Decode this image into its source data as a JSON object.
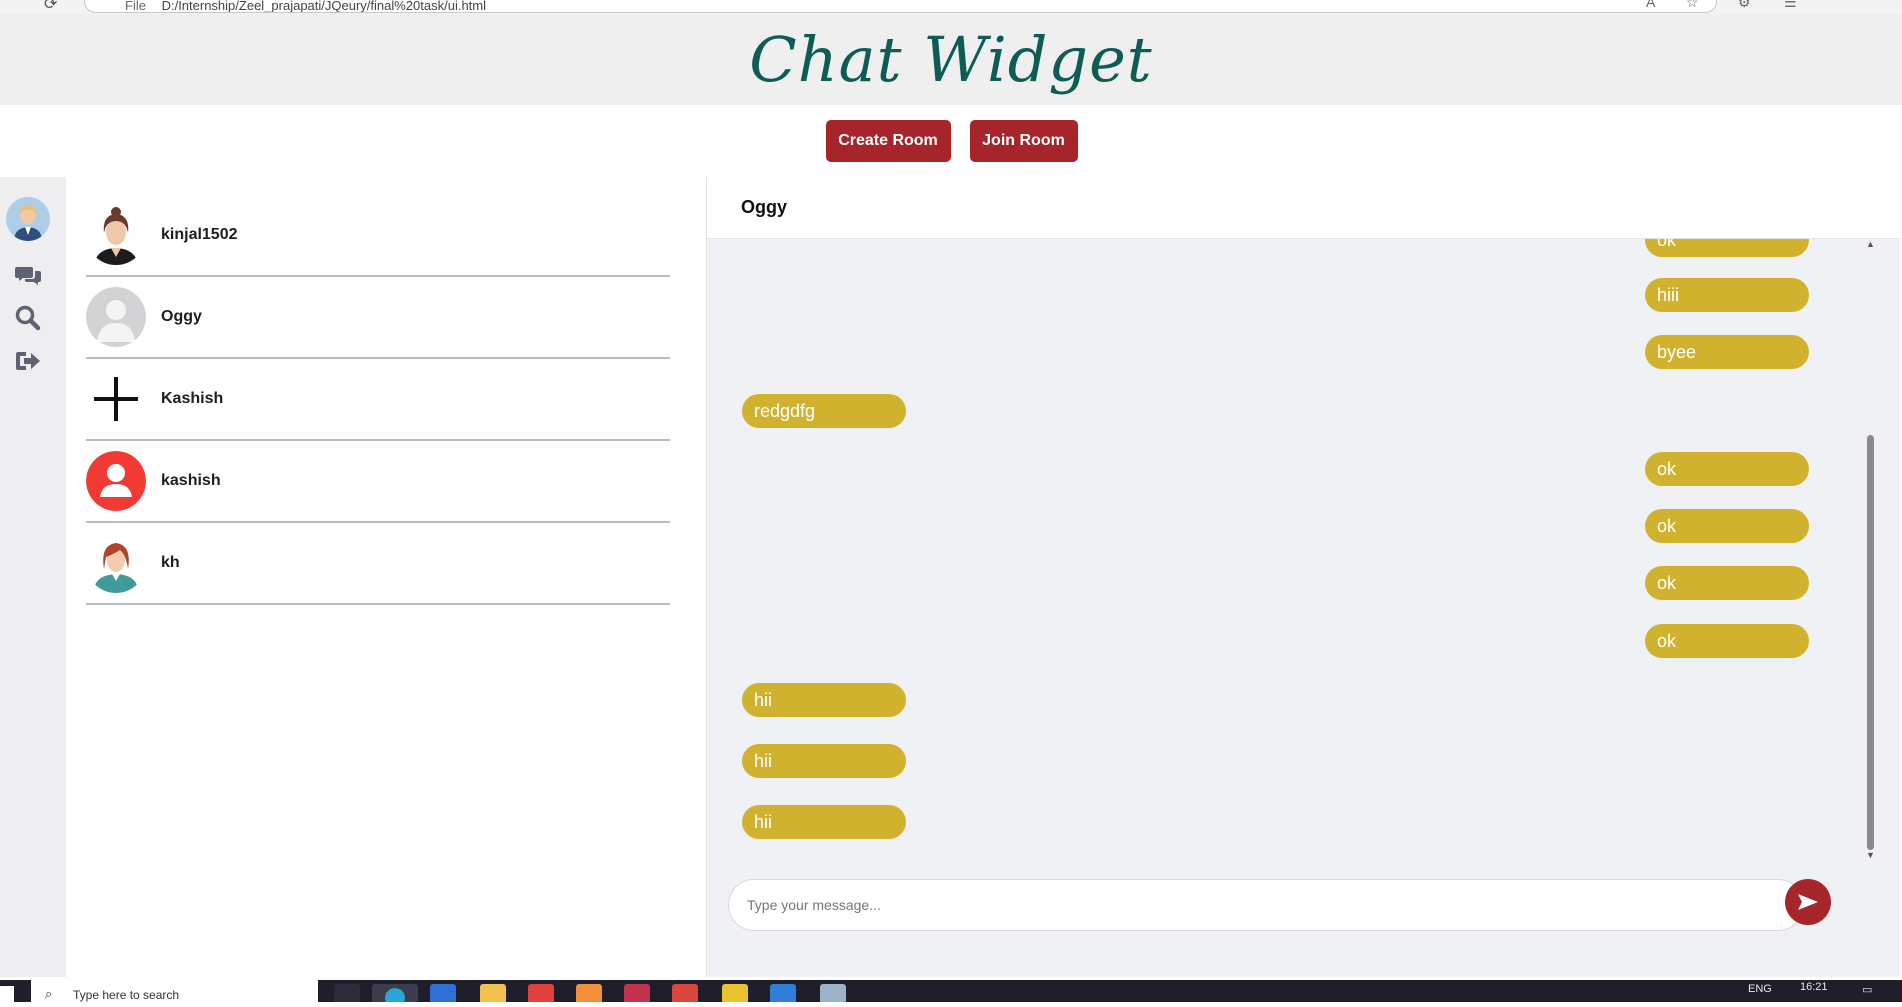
{
  "browser": {
    "file_label": "File",
    "url": "D:/Internship/Zeel_prajapati/JQeury/final%20task/ui.html"
  },
  "header": {
    "title": "Chat Widget"
  },
  "toolbar": {
    "create_label": "Create Room",
    "join_label": "Join Room"
  },
  "sidebar": {
    "icons": [
      "user-avatar-icon",
      "chat-bubbles-icon",
      "search-icon",
      "logout-icon"
    ]
  },
  "contacts": [
    {
      "name": "kinjal1502",
      "avatar": "woman-avatar-icon"
    },
    {
      "name": "Oggy",
      "avatar": "default-user-icon"
    },
    {
      "name": "Kashish",
      "avatar": "plus-icon"
    },
    {
      "name": "kashish",
      "avatar": "red-user-icon"
    },
    {
      "name": "kh",
      "avatar": "woman-teal-avatar-icon"
    }
  ],
  "chat": {
    "title": "Oggy",
    "messages": [
      {
        "text": "ok",
        "side": "sent"
      },
      {
        "text": "hiii",
        "side": "sent"
      },
      {
        "text": "byee",
        "side": "sent"
      },
      {
        "text": "redgdfg",
        "side": "received"
      },
      {
        "text": "ok",
        "side": "sent"
      },
      {
        "text": "ok",
        "side": "sent"
      },
      {
        "text": "ok",
        "side": "sent"
      },
      {
        "text": "ok",
        "side": "sent"
      },
      {
        "text": "hii",
        "side": "received"
      },
      {
        "text": "hii",
        "side": "received"
      },
      {
        "text": "hii",
        "side": "received"
      }
    ],
    "input_placeholder": "Type your message...",
    "send_icon": "send-arrow-icon"
  },
  "taskbar": {
    "search_placeholder": "Type here to search",
    "lang": "ENG",
    "time": "16:21"
  },
  "colors": {
    "accent": "#a5252a",
    "bubble": "#d1b22f",
    "title": "#0d5c55"
  }
}
